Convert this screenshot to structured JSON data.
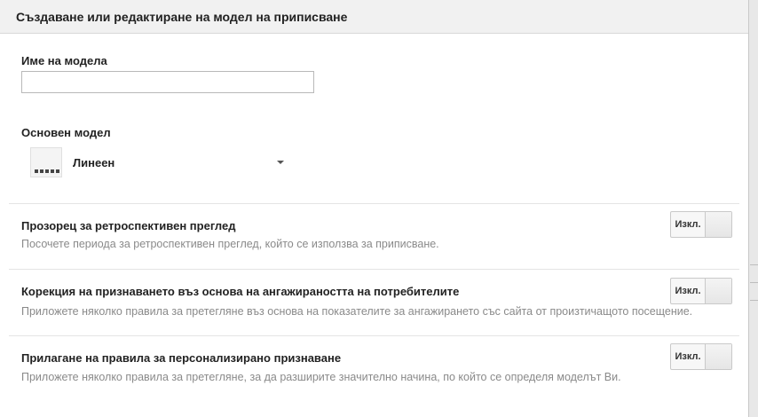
{
  "dialog": {
    "title": "Създаване или редактиране на модел на приписване"
  },
  "model_name": {
    "label": "Име на модела",
    "value": "",
    "placeholder": ""
  },
  "base_model": {
    "label": "Основен модел",
    "selected": "Линеен",
    "thumb_icon": "linear-model-icon"
  },
  "settings": [
    {
      "title": "Прозорец за ретроспективен преглед",
      "description": "Посочете периода за ретроспективен преглед, който се използва за приписване.",
      "toggle_label": "Изкл."
    },
    {
      "title": "Корекция на признаването въз основа на ангажираността на потребителите",
      "description": "Приложете няколко правила за претегляне въз основа на показателите за ангажирането със сайта от произтичащото посещение.",
      "toggle_label": "Изкл."
    },
    {
      "title": "Прилагане на правила за персонализирано признаване",
      "description": "Приложете няколко правила за претегляне, за да разширите значително начина, по който се определя моделът Ви.",
      "toggle_label": "Изкл."
    }
  ]
}
